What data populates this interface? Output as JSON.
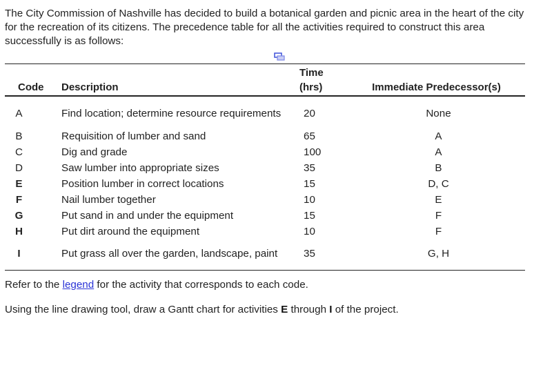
{
  "intro": "The City Commission of Nashville has decided to build a botanical garden and picnic area in the heart of the city for the recreation of its citizens. The precedence table for all the activities required to construct this area successfully is as follows:",
  "popout_icon": "popout-window-icon",
  "table": {
    "headers": {
      "code": "Code",
      "description": "Description",
      "time_line1": "Time",
      "time_line2": "(hrs)",
      "predecessors": "Immediate Predecessor(s)"
    },
    "rows": [
      {
        "code": "A",
        "description": "Find location; determine resource requirements",
        "time": "20",
        "predecessors": "None",
        "bold_code": false
      },
      {
        "code": "B",
        "description": "Requisition of lumber and sand",
        "time": "65",
        "predecessors": "A",
        "bold_code": false
      },
      {
        "code": "C",
        "description": "Dig and grade",
        "time": "100",
        "predecessors": "A",
        "bold_code": false
      },
      {
        "code": "D",
        "description": "Saw lumber into appropriate sizes",
        "time": "35",
        "predecessors": "B",
        "bold_code": false
      },
      {
        "code": "E",
        "description": "Position lumber in correct locations",
        "time": "15",
        "predecessors": "D, C",
        "bold_code": true
      },
      {
        "code": "F",
        "description": "Nail lumber together",
        "time": "10",
        "predecessors": "E",
        "bold_code": true
      },
      {
        "code": "G",
        "description": "Put sand in and under the equipment",
        "time": "15",
        "predecessors": "F",
        "bold_code": true
      },
      {
        "code": "H",
        "description": "Put dirt around the equipment",
        "time": "10",
        "predecessors": "F",
        "bold_code": true
      },
      {
        "code": "I",
        "description": "Put grass all over the garden, landscape, paint",
        "time": "35",
        "predecessors": "G, H",
        "bold_code": true
      }
    ]
  },
  "note1": {
    "before": "Refer to the ",
    "link": "legend",
    "after": " for the activity that corresponds to each code."
  },
  "note2": {
    "before": "Using the line drawing tool, draw a Gantt chart for activities ",
    "bold1": "E",
    "middle": " through ",
    "bold2": "I",
    "after": " of the project."
  },
  "colors": {
    "text": "#222222",
    "link": "#2a33d6",
    "icon": "#3b4fd9"
  }
}
